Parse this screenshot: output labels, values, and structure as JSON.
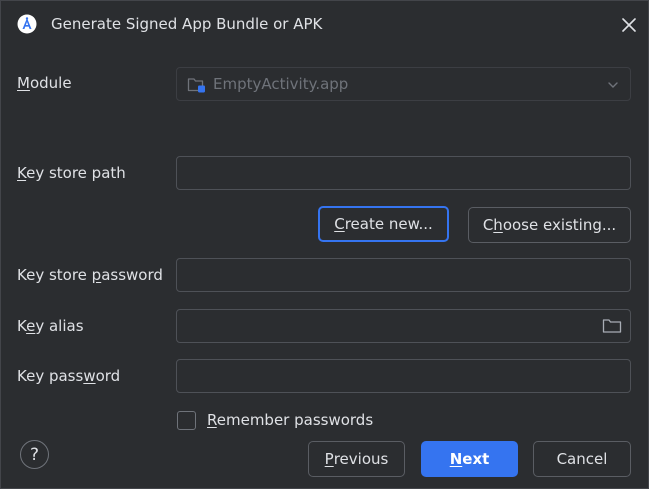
{
  "window": {
    "title": "Generate Signed App Bundle or APK",
    "app_icon": "android-studio-icon",
    "close_icon": "close-icon"
  },
  "module": {
    "label_pre": "",
    "label_key": "M",
    "label_post": "odule",
    "value": "EmptyActivity.app",
    "icon": "module-folder-icon"
  },
  "key_store_path": {
    "label_pre": "",
    "label_key": "K",
    "label_post": "ey store path",
    "value": ""
  },
  "buttons": {
    "create_new_pre": "",
    "create_new_key": "C",
    "create_new_post": "reate new...",
    "choose_existing_pre": "C",
    "choose_existing_key": "h",
    "choose_existing_post": "oose existing...",
    "previous_pre": "",
    "previous_key": "P",
    "previous_post": "revious",
    "next_pre": "",
    "next_key": "N",
    "next_post": "ext",
    "cancel": "Cancel"
  },
  "key_store_password": {
    "label_pre": "Key store ",
    "label_key": "p",
    "label_post": "assword",
    "value": ""
  },
  "key_alias": {
    "label_pre": "K",
    "label_key": "e",
    "label_post": "y alias",
    "value": "",
    "browse_icon": "folder-icon"
  },
  "key_password": {
    "label_pre": "Key pass",
    "label_key": "w",
    "label_post": "ord",
    "value": ""
  },
  "remember": {
    "label_pre": "",
    "label_key": "R",
    "label_post": "emember passwords",
    "checked": false
  },
  "help": {
    "glyph": "?"
  },
  "colors": {
    "accent": "#3574f0",
    "background": "#2b2d30",
    "text": "#dfe1e5",
    "muted": "#6f737a"
  }
}
